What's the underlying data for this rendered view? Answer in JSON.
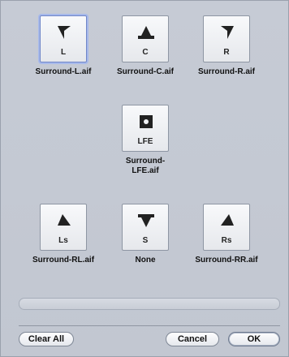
{
  "channels": [
    {
      "id": "L",
      "label": "L",
      "file": "Surround-L.aif",
      "icon": "speaker-left-icon",
      "selected": true
    },
    {
      "id": "C",
      "label": "C",
      "file": "Surround-C.aif",
      "icon": "speaker-center-icon",
      "selected": false
    },
    {
      "id": "R",
      "label": "R",
      "file": "Surround-R.aif",
      "icon": "speaker-right-icon",
      "selected": false
    },
    {
      "id": "LFE",
      "label": "LFE",
      "file": "Surround-\nLFE.aif",
      "icon": "subwoofer-icon",
      "selected": false
    },
    {
      "id": "Ls",
      "label": "Ls",
      "file": "Surround-RL.aif",
      "icon": "speaker-left-surround-icon",
      "selected": false
    },
    {
      "id": "S",
      "label": "S",
      "file": "None",
      "icon": "speaker-surround-icon",
      "selected": false
    },
    {
      "id": "Rs",
      "label": "Rs",
      "file": "Surround-RR.aif",
      "icon": "speaker-right-surround-icon",
      "selected": false
    }
  ],
  "buttons": {
    "clear_all": "Clear All",
    "cancel": "Cancel",
    "ok": "OK"
  },
  "progress": {
    "value": 0
  }
}
